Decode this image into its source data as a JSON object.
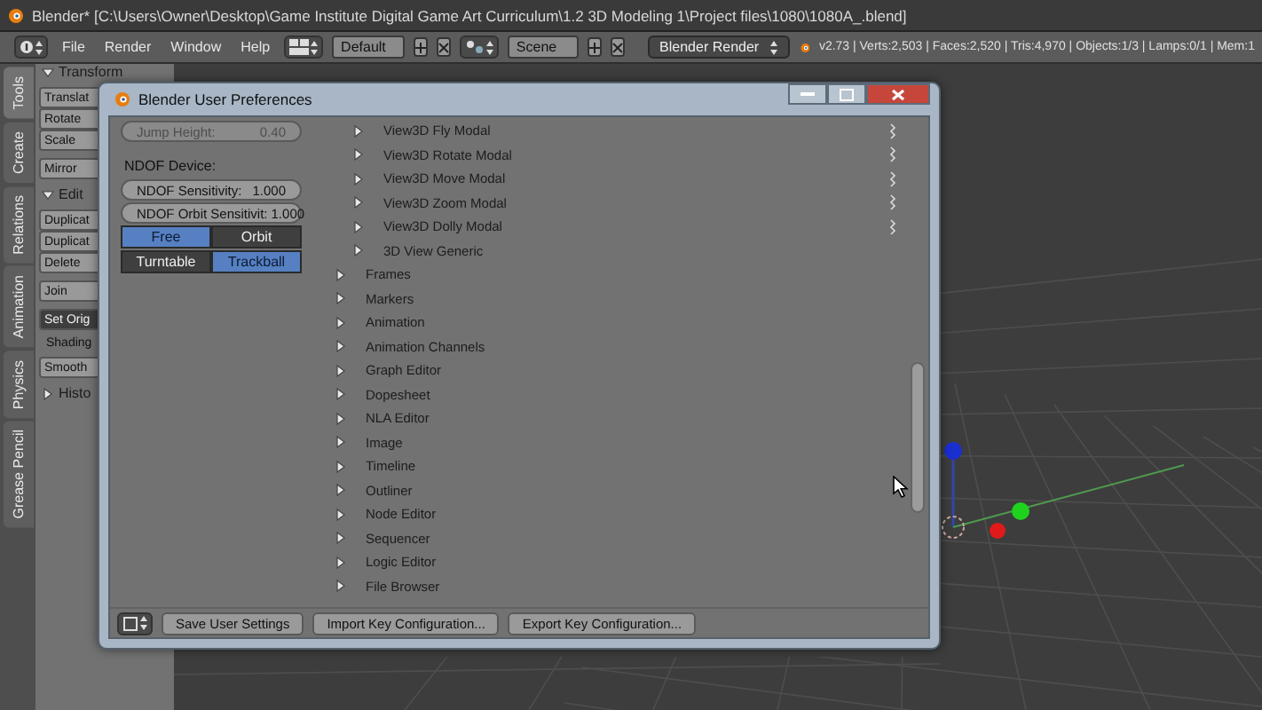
{
  "title_bar": {
    "title": "Blender* [C:\\Users\\Owner\\Desktop\\Game Institute Digital Game Art  Curriculum\\1.2 3D Modeling 1\\Project files\\1080\\1080A_.blend]"
  },
  "menu_bar": {
    "menus": [
      "File",
      "Render",
      "Window",
      "Help"
    ],
    "layout": "Default",
    "scene": "Scene",
    "engine": "Blender Render",
    "stats": "v2.73 | Verts:2,503 | Faces:2,520 | Tris:4,970 | Objects:1/3 | Lamps:0/1 | Mem:1"
  },
  "tool_tabs": [
    {
      "label": "Tools",
      "selected": true
    },
    {
      "label": "Create",
      "selected": false
    },
    {
      "label": "Relations",
      "selected": false
    },
    {
      "label": "Animation",
      "selected": false
    },
    {
      "label": "Physics",
      "selected": false
    },
    {
      "label": "Grease Pencil",
      "selected": false
    }
  ],
  "tool_panel": [
    {
      "kind": "header",
      "label": "Transform",
      "expanded": true
    },
    {
      "kind": "buttons",
      "buttons": [
        {
          "label": "Translat",
          "pressed": false
        },
        {
          "label": "Rotate",
          "pressed": false
        },
        {
          "label": "Scale",
          "pressed": false
        }
      ]
    },
    {
      "kind": "buttons",
      "buttons": [
        {
          "label": "Mirror",
          "pressed": false
        }
      ]
    },
    {
      "kind": "header",
      "label": "Edit",
      "expanded": true
    },
    {
      "kind": "buttons",
      "buttons": [
        {
          "label": "Duplicat",
          "pressed": false
        },
        {
          "label": "Duplicat",
          "pressed": false
        },
        {
          "label": "Delete",
          "pressed": false
        }
      ]
    },
    {
      "kind": "buttons",
      "buttons": [
        {
          "label": "Join",
          "pressed": false
        }
      ]
    },
    {
      "kind": "buttons",
      "buttons": [
        {
          "label": "Set Orig",
          "pressed": true
        }
      ]
    },
    {
      "kind": "label",
      "label": "Shading"
    },
    {
      "kind": "buttons",
      "buttons": [
        {
          "label": "Smooth",
          "pressed": false
        }
      ]
    },
    {
      "kind": "header",
      "label": "Histo",
      "expanded": false
    }
  ],
  "dialog": {
    "title": "Blender User Preferences",
    "settings": [
      {
        "kind": "slider",
        "label": "Jump Height:",
        "value": "0.40",
        "disabled": true
      },
      {
        "kind": "label",
        "label": "NDOF Device:"
      },
      {
        "kind": "slider",
        "label": "NDOF Sensitivity:",
        "value": "1.000",
        "disabled": false
      },
      {
        "kind": "slider",
        "label": "NDOF Orbit Sensitivit:",
        "value": "1.000",
        "disabled": false
      },
      {
        "kind": "toggle_row",
        "options": [
          {
            "label": "Free",
            "selected": true
          },
          {
            "label": "Orbit",
            "selected": false
          }
        ]
      },
      {
        "kind": "toggle_row",
        "options": [
          {
            "label": "Turntable",
            "selected": false
          },
          {
            "label": "Trackball",
            "selected": true
          }
        ]
      }
    ],
    "keymap": [
      {
        "kind": "group",
        "children": [
          {
            "label": "View3D Fly Modal",
            "expanded": false,
            "draggable": true
          },
          {
            "label": "View3D Rotate Modal",
            "expanded": false,
            "draggable": true
          },
          {
            "label": "View3D Move Modal",
            "expanded": false,
            "draggable": true
          },
          {
            "label": "View3D Zoom Modal",
            "expanded": false,
            "draggable": true
          },
          {
            "label": "View3D Dolly Modal",
            "expanded": false,
            "draggable": true
          },
          {
            "label": "3D View Generic",
            "expanded": false,
            "draggable": false
          }
        ]
      },
      {
        "kind": "item",
        "label": "Frames",
        "expanded": false
      },
      {
        "kind": "item",
        "label": "Markers",
        "expanded": false
      },
      {
        "kind": "item",
        "label": "Animation",
        "expanded": false
      },
      {
        "kind": "item",
        "label": "Animation Channels",
        "expanded": false
      },
      {
        "kind": "item",
        "label": "Graph Editor",
        "expanded": false
      },
      {
        "kind": "item",
        "label": "Dopesheet",
        "expanded": false
      },
      {
        "kind": "item",
        "label": "NLA Editor",
        "expanded": false
      },
      {
        "kind": "item",
        "label": "Image",
        "expanded": false
      },
      {
        "kind": "item",
        "label": "Timeline",
        "expanded": false
      },
      {
        "kind": "item",
        "label": "Outliner",
        "expanded": false
      },
      {
        "kind": "item",
        "label": "Node Editor",
        "expanded": false
      },
      {
        "kind": "item",
        "label": "Sequencer",
        "expanded": false
      },
      {
        "kind": "item",
        "label": "Logic Editor",
        "expanded": false
      },
      {
        "kind": "item",
        "label": "File Browser",
        "expanded": false
      }
    ],
    "footer_buttons": [
      "Save User Settings",
      "Import Key Configuration...",
      "Export Key Configuration..."
    ]
  }
}
